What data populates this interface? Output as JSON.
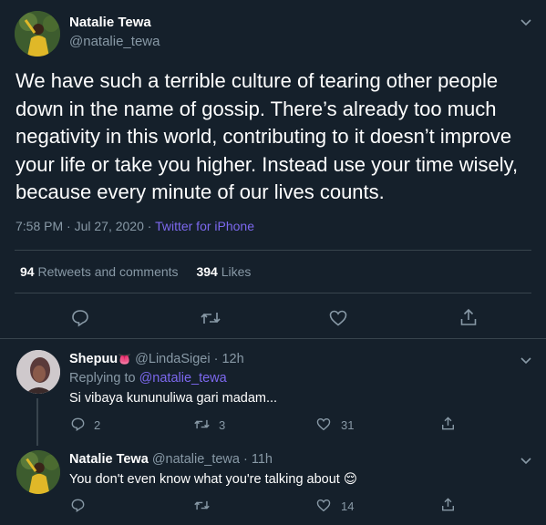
{
  "main_tweet": {
    "author_name": "Natalie Tewa",
    "author_handle": "@natalie_tewa",
    "text": "We have such a terrible culture of tearing other people down in the name of gossip. There’s already too much negativity in this world, contributing to it doesn’t improve your life or take you higher. Instead use your time wisely, because every minute of our lives counts.",
    "time": "7:58 PM · Jul 27, 2020 · ",
    "source": "Twitter for iPhone",
    "retweets_count": "94",
    "retweets_label": "Retweets and comments",
    "likes_count": "394",
    "likes_label": "Likes"
  },
  "reply1": {
    "author_name": "Shepuu",
    "emoji": "👅",
    "author_handle": "@LindaSigei",
    "time": "· 12h",
    "replying_label": "Replying to",
    "replying_handle": "@natalie_tewa",
    "text": "Si vibaya kununuliwa gari madam...",
    "reply_count": "2",
    "retweet_count": "3",
    "like_count": "31"
  },
  "reply2": {
    "author_name": "Natalie Tewa",
    "author_handle": "@natalie_tewa",
    "time": "· 11h",
    "text": "You don't even know what you're talking about 😌",
    "like_count": "14"
  },
  "colors": {
    "background": "#15202b",
    "muted": "#8899a6",
    "link": "#7c68ee",
    "divider": "#38444d"
  },
  "icons": [
    "chevron-down-icon",
    "reply-icon",
    "retweet-icon",
    "like-icon",
    "share-icon"
  ]
}
